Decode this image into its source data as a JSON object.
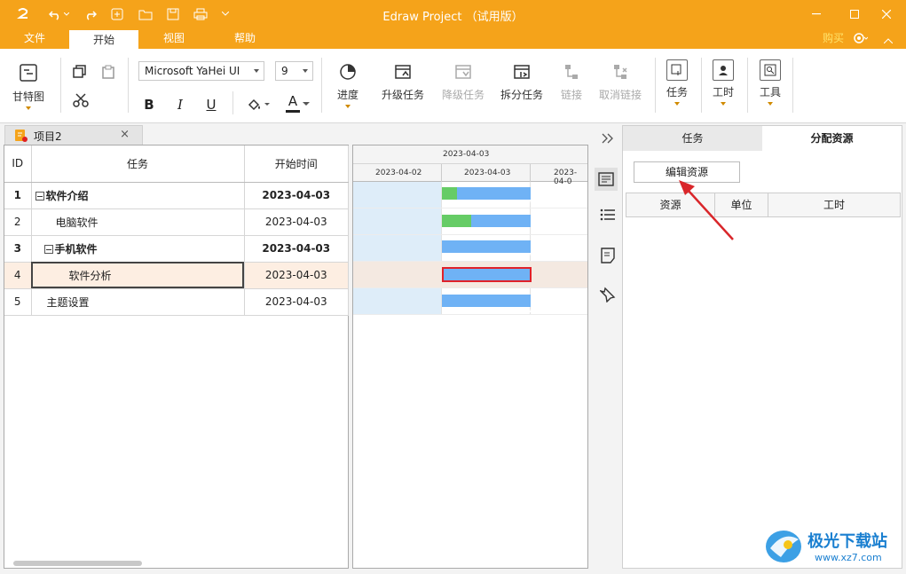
{
  "title_bar": {
    "app_title": "Edraw Project （试用版）"
  },
  "menu": {
    "items": [
      "文件",
      "开始",
      "视图",
      "帮助"
    ],
    "active": "开始",
    "buy": "购买"
  },
  "ribbon": {
    "gantt_label": "甘特图",
    "font_name": "Microsoft YaHei UI",
    "font_size": "9",
    "bold": "B",
    "italic": "I",
    "underline": "U",
    "font_color": "A",
    "progress": "进度",
    "upgrade": "升级任务",
    "downgrade": "降级任务",
    "split": "拆分任务",
    "link": "链接",
    "unlink": "取消链接",
    "task": "任务",
    "worktime": "工时",
    "tools": "工具"
  },
  "doc_tab": {
    "label": "项目2",
    "close": "×"
  },
  "grid": {
    "headers": {
      "id": "ID",
      "task": "任务",
      "start": "开始时间"
    },
    "rows": [
      {
        "id": "1",
        "task": "软件介绍",
        "start": "2023-04-03"
      },
      {
        "id": "2",
        "task": "电脑软件",
        "start": "2023-04-03"
      },
      {
        "id": "3",
        "task": "手机软件",
        "start": "2023-04-03"
      },
      {
        "id": "4",
        "task": "软件分析",
        "start": "2023-04-03"
      },
      {
        "id": "5",
        "task": "主题设置",
        "start": "2023-04-03"
      }
    ]
  },
  "gantt": {
    "top_date": "2023-04-03",
    "dates": [
      "2023-04-02",
      "2023-04-03",
      "2023-04-0"
    ]
  },
  "right_panel": {
    "tabs": [
      "任务",
      "分配资源"
    ],
    "active_tab": "分配资源",
    "edit_button": "编辑资源",
    "columns": [
      "资源",
      "单位",
      "工时"
    ]
  },
  "watermark": {
    "text": "极光下载站",
    "url": "www.xz7.com"
  },
  "colors": {
    "accent": "#f5a31a",
    "bar": "#6fb2f5",
    "progress": "#66cc66",
    "arrow": "#d9262a"
  }
}
